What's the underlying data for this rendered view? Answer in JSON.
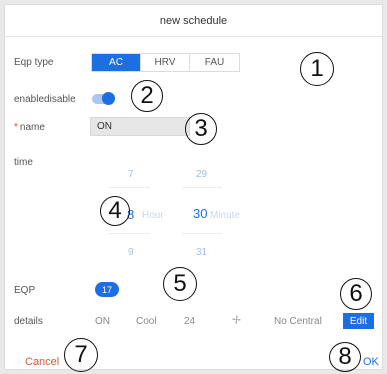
{
  "dialog": {
    "title": "new schedule"
  },
  "eqp_type": {
    "label": "Eqp type",
    "options": [
      "AC",
      "HRV",
      "FAU"
    ],
    "selected": "AC"
  },
  "enable": {
    "label": "enabledisable",
    "on": true
  },
  "name": {
    "required_mark": "*",
    "label": "name",
    "value": "ON"
  },
  "time": {
    "label": "time",
    "hour_above": "7",
    "hour_selected": "8",
    "hour_unit": "Hour",
    "hour_below": "9",
    "minute_above": "29",
    "minute_selected": "30",
    "minute_unit": "Minute",
    "minute_below": "31"
  },
  "eqp": {
    "label": "EQP",
    "count": "17"
  },
  "details": {
    "label": "details",
    "power": "ON",
    "mode": "Cool",
    "temperature": "24",
    "fan_icon": "fan-icon",
    "central": "No Central",
    "edit_label": "Edit"
  },
  "footer": {
    "cancel_label": "Cancel",
    "ok_label": "OK"
  },
  "callouts": [
    "1",
    "2",
    "3",
    "4",
    "5",
    "6",
    "7",
    "8"
  ],
  "colors": {
    "accent": "#1b6fe0",
    "cancel": "#e0563b",
    "required": "#e0463b"
  }
}
